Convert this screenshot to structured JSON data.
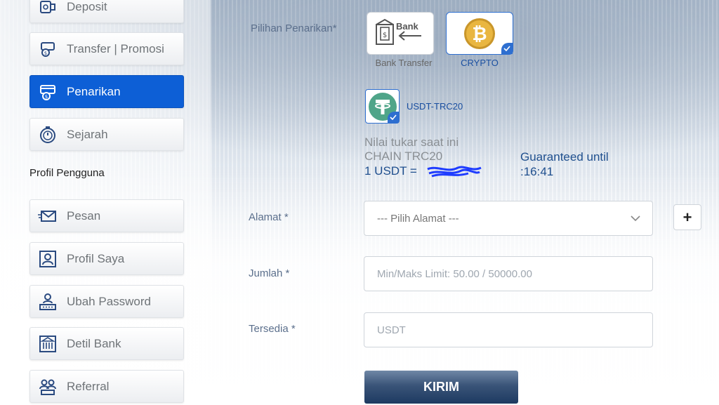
{
  "sidebar": {
    "menu": [
      {
        "label": "Deposit",
        "icon": "deposit-icon",
        "active": false
      },
      {
        "label": "Transfer | Promosi",
        "icon": "transfer-icon",
        "active": false
      },
      {
        "label": "Penarikan",
        "icon": "withdraw-icon",
        "active": true
      },
      {
        "label": "Sejarah",
        "icon": "history-icon",
        "active": false
      }
    ],
    "section_title": "Profil Pengguna",
    "profile_menu": [
      {
        "label": "Pesan",
        "icon": "message-icon"
      },
      {
        "label": "Profil Saya",
        "icon": "profile-icon"
      },
      {
        "label": "Ubah Password",
        "icon": "password-icon"
      },
      {
        "label": "Detil Bank",
        "icon": "bank-icon"
      },
      {
        "label": "Referral",
        "icon": "referral-icon"
      }
    ]
  },
  "withdraw": {
    "method_label": "Pilihan Penarikan*",
    "methods": [
      {
        "label": "Bank Transfer",
        "icon_text": "Bank",
        "selected": false
      },
      {
        "label": "CRYPTO",
        "selected": true
      }
    ],
    "coin": {
      "label": "USDT-TRC20",
      "selected": true
    },
    "rate": {
      "line1": "Nilai tukar saat ini",
      "line2": "CHAIN TRC20",
      "line3": "1 USDT =",
      "guaranteed_label": "Guaranteed until",
      "guaranteed_time": ":16:41"
    },
    "address": {
      "label": "Alamat *",
      "value": "--- Pilih Alamat ---",
      "add_label": "+"
    },
    "amount": {
      "label": "Jumlah  *",
      "placeholder": "Min/Maks Limit: 50.00 / 50000.00"
    },
    "available": {
      "label": "Tersedia *",
      "placeholder": "USDT"
    },
    "submit_label": "KIRIM"
  },
  "colors": {
    "active_menu": "#0d5fd6",
    "accent_blue": "#2e6fd0",
    "label_blue": "#1f4f8e",
    "crypto_text": "#1a4fa0",
    "submit_dark": "#1d3a61"
  }
}
